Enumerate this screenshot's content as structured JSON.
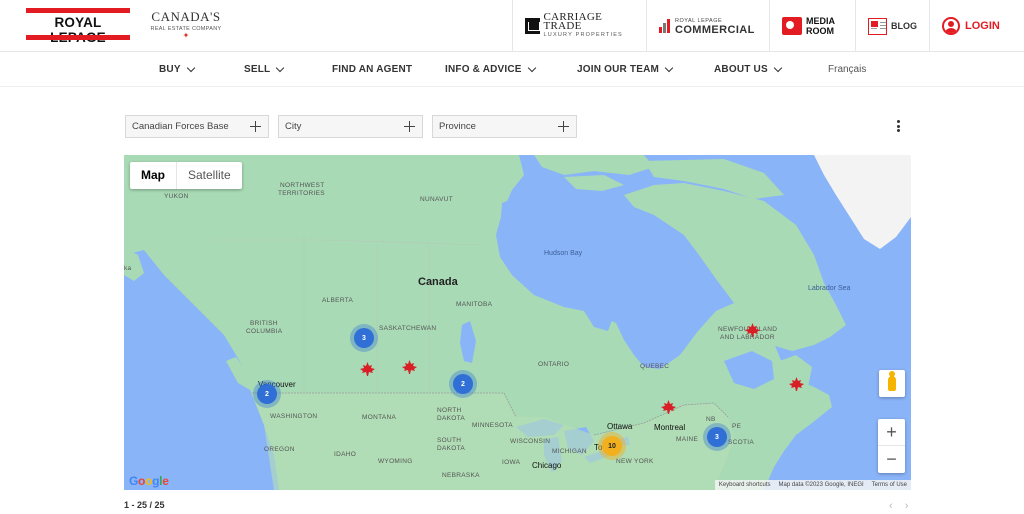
{
  "header": {
    "logo_text": "ROYAL LEPAGE",
    "tagline_big": "CANADA'S",
    "tagline_small": "REAL ESTATE COMPANY",
    "carriage_trade": {
      "line1": "CARRIAGE TRADE",
      "line2": "LUXURY PROPERTIES"
    },
    "commercial": {
      "line1": "ROYAL LEPAGE",
      "line2": "COMMERCIAL"
    },
    "media_room": {
      "line1": "MEDIA",
      "line2": "ROOM"
    },
    "blog_label": "BLOG",
    "login_label": "LOGIN"
  },
  "nav": {
    "items": [
      {
        "label": "BUY",
        "dropdown": true
      },
      {
        "label": "SELL",
        "dropdown": true
      },
      {
        "label": "FIND AN AGENT",
        "dropdown": false
      },
      {
        "label": "INFO & ADVICE",
        "dropdown": true
      },
      {
        "label": "JOIN OUR TEAM",
        "dropdown": true
      },
      {
        "label": "ABOUT US",
        "dropdown": true
      }
    ],
    "language": "Français"
  },
  "filters": [
    {
      "label": "Canadian Forces Base"
    },
    {
      "label": "City"
    },
    {
      "label": "Province"
    }
  ],
  "map": {
    "type_map": "Map",
    "type_satellite": "Satellite",
    "labels": {
      "yukon": "YUKON",
      "nwt_1": "NORTHWEST",
      "nwt_2": "TERRITORIES",
      "nunavut": "NUNAVUT",
      "alberta": "ALBERTA",
      "bc_1": "BRITISH",
      "bc_2": "COLUMBIA",
      "saskatchewan": "SASKATCHEWAN",
      "manitoba": "MANITOBA",
      "ontario": "ONTARIO",
      "quebec": "QUEBEC",
      "newfoundland_1": "NEWFOUNDLAND",
      "newfoundland_2": "AND LABRADOR",
      "washington": "WASHINGTON",
      "montana": "MONTANA",
      "north_dakota_1": "NORTH",
      "north_dakota_2": "DAKOTA",
      "minnesota": "MINNESOTA",
      "oregon": "OREGON",
      "idaho": "IDAHO",
      "south_dakota_1": "SOUTH",
      "south_dakota_2": "DAKOTA",
      "wisconsin": "WISCONSIN",
      "michigan": "MICHIGAN",
      "wyoming": "WYOMING",
      "nebraska": "NEBRASKA",
      "iowa": "IOWA",
      "maine": "MAINE",
      "nb": "NB",
      "pe": "PE",
      "nova_scotia": "SCOTIA",
      "new_york": "NEW YORK",
      "canada": "Canada",
      "vancouver": "Vancouver",
      "ottawa": "Ottawa",
      "montreal": "Montreal",
      "toronto": "To",
      "chicago": "Chicago",
      "hudson_bay": "Hudson Bay",
      "labrador_sea": "Labrador Sea",
      "alaska_cut": "ka"
    },
    "clusters": [
      {
        "id": "sask",
        "count": "3"
      },
      {
        "id": "manitoba",
        "count": "2"
      },
      {
        "id": "vancouver",
        "count": "2"
      },
      {
        "id": "toronto",
        "count": "10"
      },
      {
        "id": "maritimes",
        "count": "3"
      }
    ],
    "attribution": {
      "shortcuts": "Keyboard shortcuts",
      "data": "Map data ©2023 Google, INEGI",
      "terms": "Terms of Use"
    },
    "google": "Google",
    "colors": {
      "land": "#a8dab5",
      "water": "#8ab4f8",
      "cluster_blue": "#2f6fd6",
      "cluster_yellow": "#f2b01e",
      "pin_red": "#d81f26"
    }
  },
  "results": {
    "count_text": "1 - 25 / 25"
  },
  "pager": {
    "prev": "‹",
    "next": "›"
  }
}
